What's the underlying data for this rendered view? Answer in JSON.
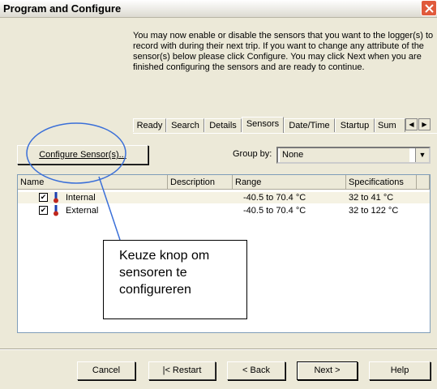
{
  "window": {
    "title": "Program and Configure"
  },
  "instructions": "You may now enable or disable the sensors that you want to the logger(s) to record with during their next trip. If you want to change any attribute of the sensor(s) below please click Configure. You may click Next when you are finished configuring the sensors and are ready to continue.",
  "tabs": [
    {
      "label": "Ready"
    },
    {
      "label": "Search"
    },
    {
      "label": "Details"
    },
    {
      "label": "Sensors"
    },
    {
      "label": "Date/Time"
    },
    {
      "label": "Startup"
    },
    {
      "label": "Sum"
    }
  ],
  "active_tab": "Sensors",
  "configure_button": "Configure Sensor(s)...",
  "group_by": {
    "label": "Group by:",
    "value": "None"
  },
  "columns": [
    "Name",
    "Description",
    "Range",
    "Specifications"
  ],
  "rows": [
    {
      "checked": true,
      "name": "Internal",
      "description": "",
      "range": "-40.5 to 70.4 °C",
      "specifications": "32 to 41 °C"
    },
    {
      "checked": true,
      "name": "External",
      "description": "",
      "range": "-40.5 to 70.4 °C",
      "specifications": "32 to 122 °C"
    }
  ],
  "buttons": {
    "cancel": "Cancel",
    "restart": "|< Restart",
    "back": "< Back",
    "next": "Next >",
    "help": "Help"
  },
  "callout": {
    "line1": "Keuze knop om",
    "line2": "sensoren te",
    "line3": "configureren"
  },
  "colors": {
    "annotation": "#3a6fd8",
    "close": "#e05a3c"
  }
}
